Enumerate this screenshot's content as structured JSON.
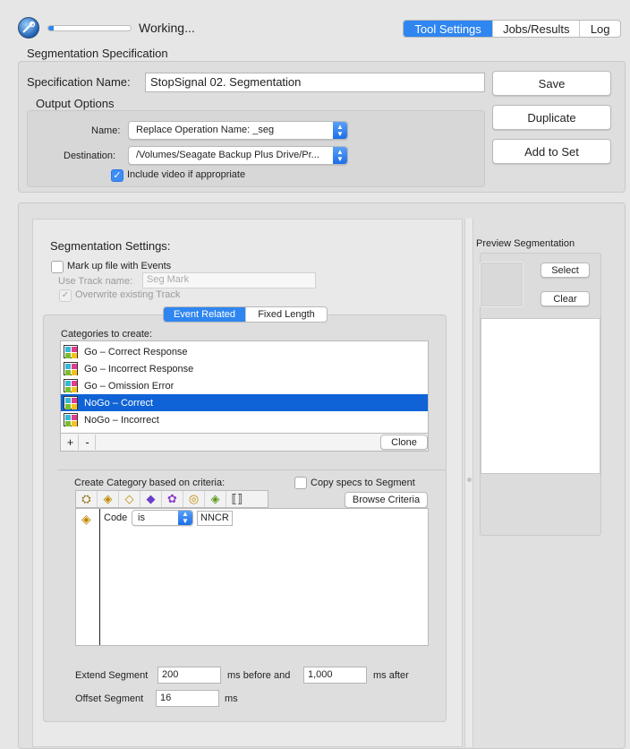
{
  "toolbar": {
    "status": "Working...",
    "tabs": [
      "Tool Settings",
      "Jobs/Results",
      "Log"
    ],
    "selected_tab": 0,
    "progress_fraction": 0.06
  },
  "spec": {
    "section_title": "Segmentation Specification",
    "name_label": "Specification Name:",
    "name_value": "StopSignal 02. Segmentation",
    "output_options_title": "Output Options",
    "name_field_label": "Name:",
    "name_popup_value": "Replace Operation Name: _seg",
    "destination_label": "Destination:",
    "destination_value": "/Volumes/Seagate Backup Plus Drive/Pr...",
    "include_video_label": "Include video if appropriate",
    "include_video_checked": true,
    "save_button": "Save",
    "duplicate_button": "Duplicate",
    "add_to_set_button": "Add to Set"
  },
  "settings": {
    "title": "Segmentation Settings:",
    "mark_up_label": "Mark up file with Events",
    "use_track_label": "Use Track name:",
    "use_track_placeholder": "Seg Mark",
    "overwrite_label": "Overwrite existing Track",
    "mode_tabs": [
      "Event Related",
      "Fixed Length"
    ],
    "selected_mode": 0,
    "categories_label": "Categories to create:",
    "categories": [
      {
        "label": "Go – Correct Response",
        "selected": false
      },
      {
        "label": "Go – Incorrect Response",
        "selected": false
      },
      {
        "label": "Go – Omission Error",
        "selected": false
      },
      {
        "label": "NoGo – Correct",
        "selected": true
      },
      {
        "label": "NoGo – Incorrect",
        "selected": false
      }
    ],
    "add_button": "+",
    "remove_button": "-",
    "clone_button": "Clone",
    "criteria_label": "Create Category based on criteria:",
    "copy_specs_label": "Copy specs to Segment",
    "browse_criteria_button": "Browse Criteria",
    "criteria_row": {
      "field": "Code",
      "operator": "is",
      "value": "NNCR"
    },
    "extend_label": "Extend Segment",
    "extend_before": "200",
    "before_label": "ms before and",
    "extend_after": "1,000",
    "after_label": "ms after",
    "offset_label": "Offset Segment",
    "offset_value": "16",
    "offset_unit": "ms"
  },
  "preview": {
    "title": "Preview Segmentation",
    "select_button": "Select",
    "clear_button": "Clear"
  },
  "colors": {
    "accent": "#2f86f0",
    "selection": "#0f63d6"
  }
}
